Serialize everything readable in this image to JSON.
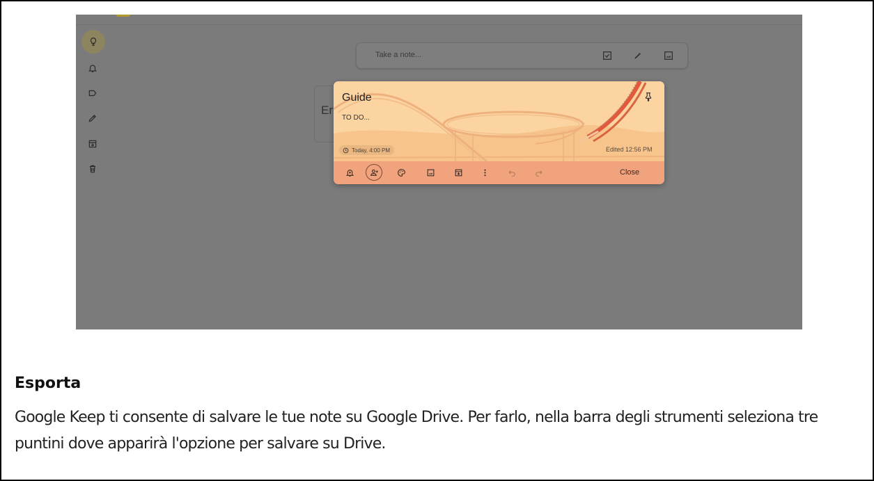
{
  "keep": {
    "take_note_placeholder": "Take a note...",
    "background_note_snippet": "Er",
    "note": {
      "title": "Guide",
      "body": "TO DO...",
      "reminder": "Today, 4:00 PM",
      "edited": "Edited 12:56 PM",
      "close_label": "Close",
      "color": "#fbd5a3",
      "toolbar_color": "#f1a37d"
    },
    "sidebar_icons": [
      "lightbulb-icon",
      "bell-icon",
      "label-icon",
      "pencil-icon",
      "archive-icon",
      "trash-icon"
    ],
    "note_toolbar_icons": [
      "bell-plus-icon",
      "add-collaborator-icon",
      "palette-icon",
      "image-icon",
      "archive-icon",
      "more-vert-icon",
      "undo-icon",
      "redo-icon"
    ]
  },
  "article": {
    "heading": "Esporta",
    "paragraph": "Google Keep ti consente di salvare le tue note su Google Drive. Per farlo, nella barra degli strumenti seleziona tre puntini dove apparirà l'opzione per salvare su Drive."
  }
}
